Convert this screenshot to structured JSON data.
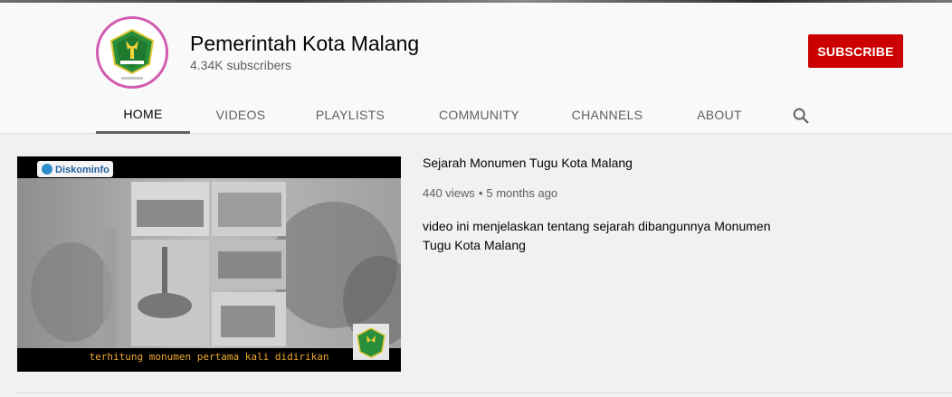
{
  "channel": {
    "name": "Pemerintah Kota Malang",
    "subscribers": "4.34K subscribers",
    "subscribe_label": "SUBSCRIBE",
    "avatar_icon": "malang-city-emblem-icon"
  },
  "tabs": [
    {
      "label": "HOME",
      "active": true
    },
    {
      "label": "VIDEOS",
      "active": false
    },
    {
      "label": "PLAYLISTS",
      "active": false
    },
    {
      "label": "COMMUNITY",
      "active": false
    },
    {
      "label": "CHANNELS",
      "active": false
    },
    {
      "label": "ABOUT",
      "active": false
    }
  ],
  "search_icon": "search-icon",
  "featured_video": {
    "title": "Sejarah Monumen Tugu Kota Malang",
    "views": "440 views",
    "age": "5 months ago",
    "description": "video ini menjelaskan tentang sejarah dibangunnya Monumen Tugu Kota Malang",
    "thumbnail_caption": "terhitung monumen pertama kali didirikan",
    "thumbnail_logo": "Diskominfo"
  },
  "colors": {
    "subscribe_red": "#cc0000",
    "caption_orange": "#f0a830",
    "page_bg": "#f1f1f1",
    "header_bg": "#f9f9f9"
  }
}
